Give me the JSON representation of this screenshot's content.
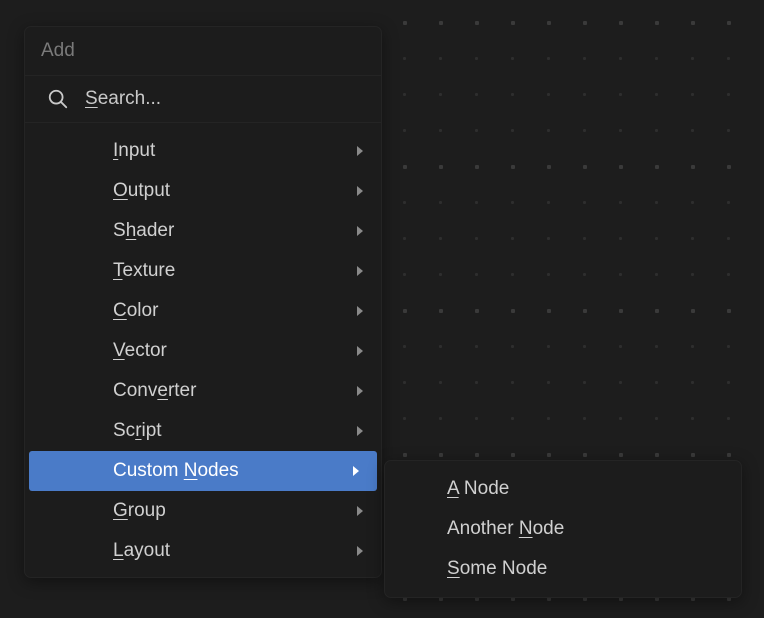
{
  "header": {
    "title": "Add"
  },
  "search": {
    "placeholder_pre": "S",
    "placeholder_rest": "earch..."
  },
  "menu": [
    {
      "u": "I",
      "rest": "nput",
      "has_sub": true,
      "selected": false
    },
    {
      "u": "O",
      "rest": "utput",
      "has_sub": true,
      "selected": false
    },
    {
      "pre": "S",
      "u": "h",
      "rest": "ader",
      "has_sub": true,
      "selected": false
    },
    {
      "u": "T",
      "rest": "exture",
      "has_sub": true,
      "selected": false
    },
    {
      "u": "C",
      "rest": "olor",
      "has_sub": true,
      "selected": false
    },
    {
      "u": "V",
      "rest": "ector",
      "has_sub": true,
      "selected": false
    },
    {
      "pre": "Conv",
      "u": "e",
      "rest": "rter",
      "has_sub": true,
      "selected": false
    },
    {
      "pre": "Sc",
      "u": "r",
      "rest": "ipt",
      "has_sub": true,
      "selected": false
    },
    {
      "pre": "Custom ",
      "u": "N",
      "rest": "odes",
      "has_sub": true,
      "selected": true
    },
    {
      "u": "G",
      "rest": "roup",
      "has_sub": true,
      "selected": false
    },
    {
      "u": "L",
      "rest": "ayout",
      "has_sub": true,
      "selected": false
    }
  ],
  "submenu": [
    {
      "u": "A",
      "rest": " Node"
    },
    {
      "pre": "Another ",
      "u": "N",
      "rest": "ode"
    },
    {
      "u": "S",
      "rest": "ome Node"
    }
  ]
}
